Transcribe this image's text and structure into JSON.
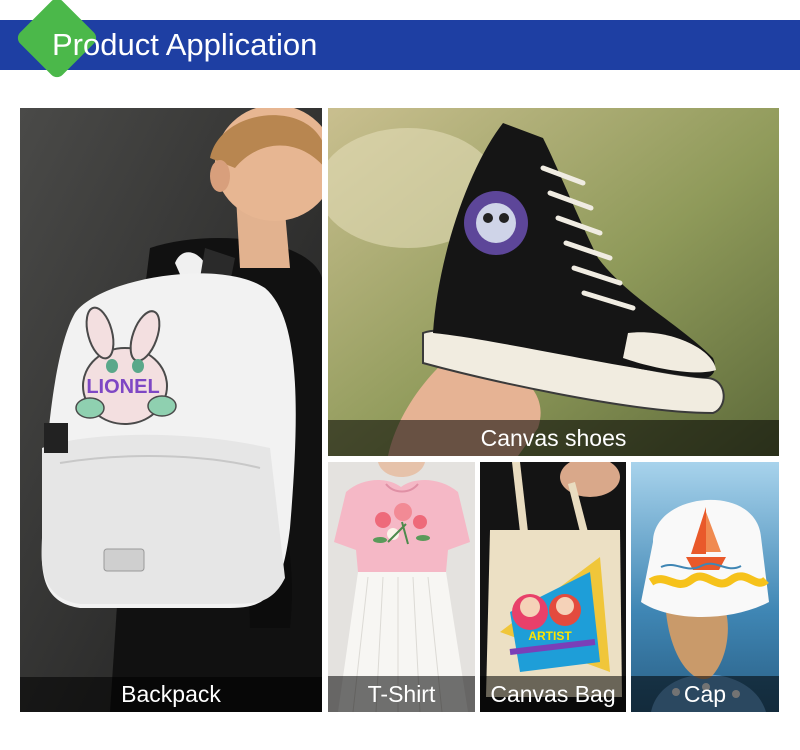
{
  "header": {
    "title": "Product Application"
  },
  "tiles": {
    "backpack": {
      "label": "Backpack",
      "print_text": "LIONEL"
    },
    "shoes": {
      "label": "Canvas shoes"
    },
    "tshirt": {
      "label": "T-Shirt"
    },
    "bag": {
      "label": "Canvas Bag",
      "print_text": "ARTIST"
    },
    "cap": {
      "label": "Cap"
    }
  },
  "colors": {
    "banner": "#1e3fa3",
    "diamond": "#4bb84a",
    "caption_bg": "rgba(0,0,0,0.55)"
  }
}
